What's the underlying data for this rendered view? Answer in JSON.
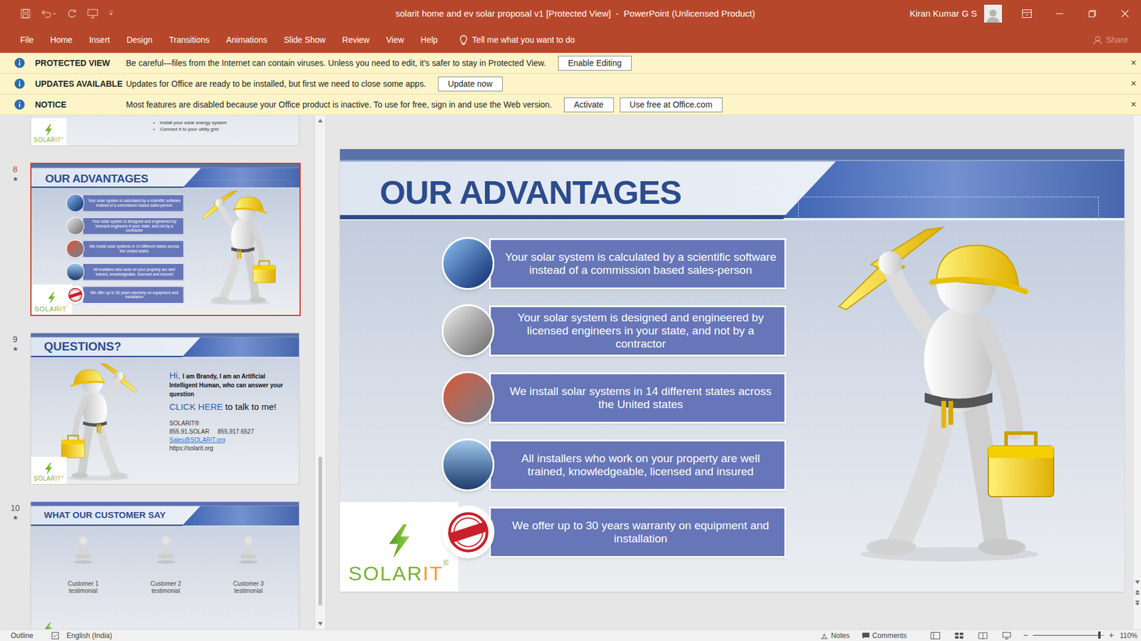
{
  "window": {
    "title": "solarit home and ev solar proposal v1 [Protected View]  -  PowerPoint (Unlicensed Product)",
    "user": "Kiran Kumar G S"
  },
  "ribbon": {
    "tabs": [
      {
        "label": "File",
        "selected": false
      },
      {
        "label": "Home",
        "selected": false
      },
      {
        "label": "Insert",
        "selected": false
      },
      {
        "label": "Design",
        "selected": false
      },
      {
        "label": "Transitions",
        "selected": false
      },
      {
        "label": "Animations",
        "selected": false
      },
      {
        "label": "Slide Show",
        "selected": false
      },
      {
        "label": "Review",
        "selected": false
      },
      {
        "label": "View",
        "selected": false
      },
      {
        "label": "Help",
        "selected": false
      }
    ],
    "tell_me": "Tell me what you want to do",
    "share": {
      "label": "Share",
      "disabled": true
    }
  },
  "notices": [
    {
      "label": "PROTECTED VIEW",
      "message": "Be careful—files from the Internet can contain viruses. Unless you need to edit, it's safer to stay in Protected View.",
      "buttons": [
        "Enable Editing"
      ],
      "close": "×"
    },
    {
      "label": "UPDATES AVAILABLE",
      "message": "Updates for Office are ready to be installed, but first we need to close some apps.",
      "buttons": [
        "Update now"
      ],
      "close": "×"
    },
    {
      "label": "NOTICE",
      "message": "Most features are disabled because your Office product is inactive. To use for free, sign in and use the Web version.",
      "buttons": [
        "Activate",
        "Use free at Office.com"
      ],
      "close": "×"
    }
  ],
  "thumbnails": [
    {
      "kind": "bullets",
      "selected": false,
      "bullets": [
        "Install your solar energy system",
        "Connect it to your utility grid"
      ]
    },
    {
      "kind": "advantages",
      "number": "8",
      "star": "★",
      "selected": true
    },
    {
      "kind": "questions",
      "number": "9",
      "star": "★",
      "selected": false,
      "title": "QUESTIONS?",
      "greeting": "Hi,",
      "intro": "I am Brandy, I am an Artificial Intelligent Human, who can answer your question",
      "link": "CLICK HERE",
      "cta": "to talk to me!",
      "company": "SOLARIT®",
      "phones": [
        "855.91.SOLAR",
        "855,917.6527"
      ],
      "email": "Sales@SOLARIT.org",
      "url": "https://solarit.org"
    },
    {
      "kind": "testimonials",
      "number": "10",
      "star": "★",
      "selected": false,
      "title": "WHAT OUR CUSTOMER SAY",
      "captions": [
        "Customer 1 testimonial",
        "Customer 2 testimonial",
        "Customer 3 testimonial"
      ]
    }
  ],
  "slide": {
    "title": "OUR ADVANTAGES",
    "advantages": [
      "Your solar system is calculated by a scientific software instead of a commission based sales-person",
      "Your solar system is designed and engineered by licensed engineers in your state, and not by a contractor",
      "We install solar systems in 14 different states across the United states",
      "All installers who work on your property are well trained, knowledgeable, licensed and insured",
      "We offer up to 30 years warranty on equipment and installation"
    ],
    "logo": {
      "solar": "SOLAR",
      "it": "IT",
      "reg": "®"
    }
  },
  "status_bar": {
    "view": "Outline",
    "language": "English (India)",
    "notes": "Notes",
    "comments": "Comments",
    "zoom_out": "−",
    "zoom_in": "+",
    "zoom": "110%",
    "zoom_level": 0.93
  }
}
